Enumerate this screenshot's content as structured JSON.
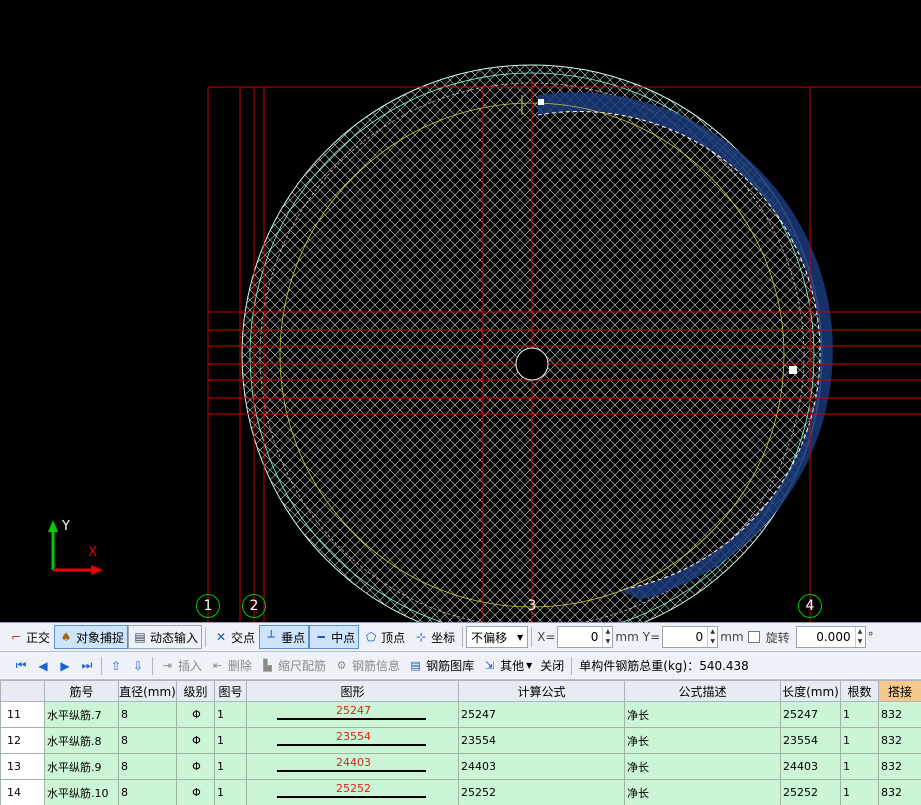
{
  "canvas": {
    "axis_x_label": "X",
    "axis_y_label": "Y",
    "grid_bubbles": [
      "1",
      "2",
      "3",
      "4"
    ],
    "colors": {
      "background": "#000000",
      "grid_line": "#cc0000",
      "hatch": "#ffffff",
      "ring_fill": "#1a3a7a",
      "bubble": "#00cc00"
    }
  },
  "snap_toolbar": {
    "ortho": "正交",
    "object_snap": "对象捕捉",
    "dynamic_input": "动态输入",
    "intersection": "交点",
    "perpendicular": "垂点",
    "midpoint": "中点",
    "vertex": "顶点",
    "coordinate": "坐标",
    "offset_select": "不偏移",
    "x_label": "X=",
    "x_value": "0",
    "unit_mm_1": "mm",
    "y_label": "Y=",
    "y_value": "0",
    "unit_mm_2": "mm",
    "rotate": "旋转",
    "rotate_value": "0.000",
    "degree": "°"
  },
  "rebar_toolbar": {
    "insert": "插入",
    "delete": "删除",
    "scale_rebar": "缩尺配筋",
    "rebar_info": "钢筋信息",
    "rebar_library": "钢筋图库",
    "other": "其他",
    "close": "关闭",
    "total_weight": "单构件钢筋总重(kg)：540.438"
  },
  "table": {
    "headers": [
      "",
      "筋号",
      "直径(mm)",
      "级别",
      "图号",
      "图形",
      "计算公式",
      "公式描述",
      "长度(mm)",
      "根数",
      "搭接"
    ],
    "rows": [
      {
        "index": "11",
        "name": "水平纵筋.7",
        "diameter": "8",
        "grade": "Φ",
        "fig": "1",
        "shape_value": "25247",
        "formula": "25247",
        "description": "净长",
        "length": "25247",
        "count": "1",
        "lap": "832"
      },
      {
        "index": "12",
        "name": "水平纵筋.8",
        "diameter": "8",
        "grade": "Φ",
        "fig": "1",
        "shape_value": "23554",
        "formula": "23554",
        "description": "净长",
        "length": "23554",
        "count": "1",
        "lap": "832"
      },
      {
        "index": "13",
        "name": "水平纵筋.9",
        "diameter": "8",
        "grade": "Φ",
        "fig": "1",
        "shape_value": "24403",
        "formula": "24403",
        "description": "净长",
        "length": "24403",
        "count": "1",
        "lap": "832"
      },
      {
        "index": "14",
        "name": "水平纵筋.10",
        "diameter": "8",
        "grade": "Φ",
        "fig": "1",
        "shape_value": "25252",
        "formula": "25252",
        "description": "净长",
        "length": "25252",
        "count": "1",
        "lap": "832"
      }
    ]
  }
}
